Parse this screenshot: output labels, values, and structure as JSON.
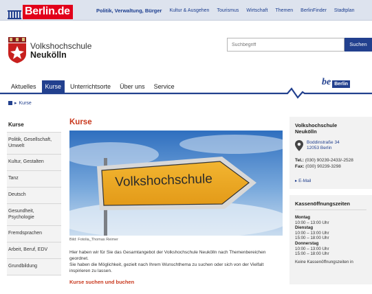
{
  "portal": {
    "logo_text": "Berlin.de",
    "nav": [
      {
        "label": "Politik, Verwaltung, Bürger",
        "strong": true
      },
      {
        "label": "Kultur & Ausgehen"
      },
      {
        "label": "Tourismus"
      },
      {
        "label": "Wirtschaft"
      },
      {
        "label": "Themen"
      },
      {
        "label": "BerlinFinder"
      },
      {
        "label": "Stadtplan"
      }
    ]
  },
  "site": {
    "title_line1": "Volkshochschule",
    "title_line2": "Neukölln"
  },
  "search": {
    "placeholder": "Suchbegriff",
    "button_label": "Suchen"
  },
  "mainnav": {
    "items": [
      "Aktuelles",
      "Kurse",
      "Unterrichtsorte",
      "Über uns",
      "Service"
    ],
    "active": "Kurse",
    "be_text": "be",
    "be_berlin_text": "Berlin"
  },
  "breadcrumb": {
    "current": "Kurse"
  },
  "sidebar": {
    "heading": "Kurse",
    "items": [
      "Politik, Gesellschaft, Umwelt",
      "Kultur, Gestalten",
      "Tanz",
      "Deutsch",
      "Gesundheit, Psychologie",
      "Fremdsprachen",
      "Arbeit, Beruf, EDV",
      "Grundbildung"
    ]
  },
  "main": {
    "title": "Kurse",
    "sign_text": "Volkshochschule",
    "caption": "Bild: Fotolia_Thomas Reimer",
    "intro_line1": "Hier haben wir für Sie das Gesamtangebot der Volkshochschule Neukölln nach Themenbereichen geordnet.",
    "intro_line2": "Sie haben die Möglichkeit, gezielt nach Ihrem Wunschthema zu suchen oder sich von der Vielfalt inspirieren zu lassen.",
    "subheading": "Kurse suchen und buchen"
  },
  "contact": {
    "title_line1": "Volkshochschule",
    "title_line2": "Neukölln",
    "street": "Boddinstraße 34",
    "city": "12053 Berlin",
    "tel_label": "Tel.:",
    "tel": "(030) 90239-2433/-2528",
    "fax_label": "Fax:",
    "fax": "(030) 90239-3298",
    "email_label": "E-Mail"
  },
  "hours": {
    "title": "Kassenöffnungszeiten",
    "days": [
      {
        "day": "Montag",
        "times": [
          "10:00 – 13:00 Uhr"
        ]
      },
      {
        "day": "Dienstag",
        "times": [
          "10:00 – 13:00 Uhr",
          "15:00 – 18:00 Uhr"
        ]
      },
      {
        "day": "Donnerstag",
        "times": [
          "10:00 – 13:00 Uhr",
          "15:00 – 18:00 Uhr"
        ]
      }
    ],
    "note": "Keine Kassenöffnungszeiten in"
  },
  "colors": {
    "brand_blue": "#22408e",
    "accent_red": "#c8371c",
    "portal_red": "#e2001a"
  }
}
